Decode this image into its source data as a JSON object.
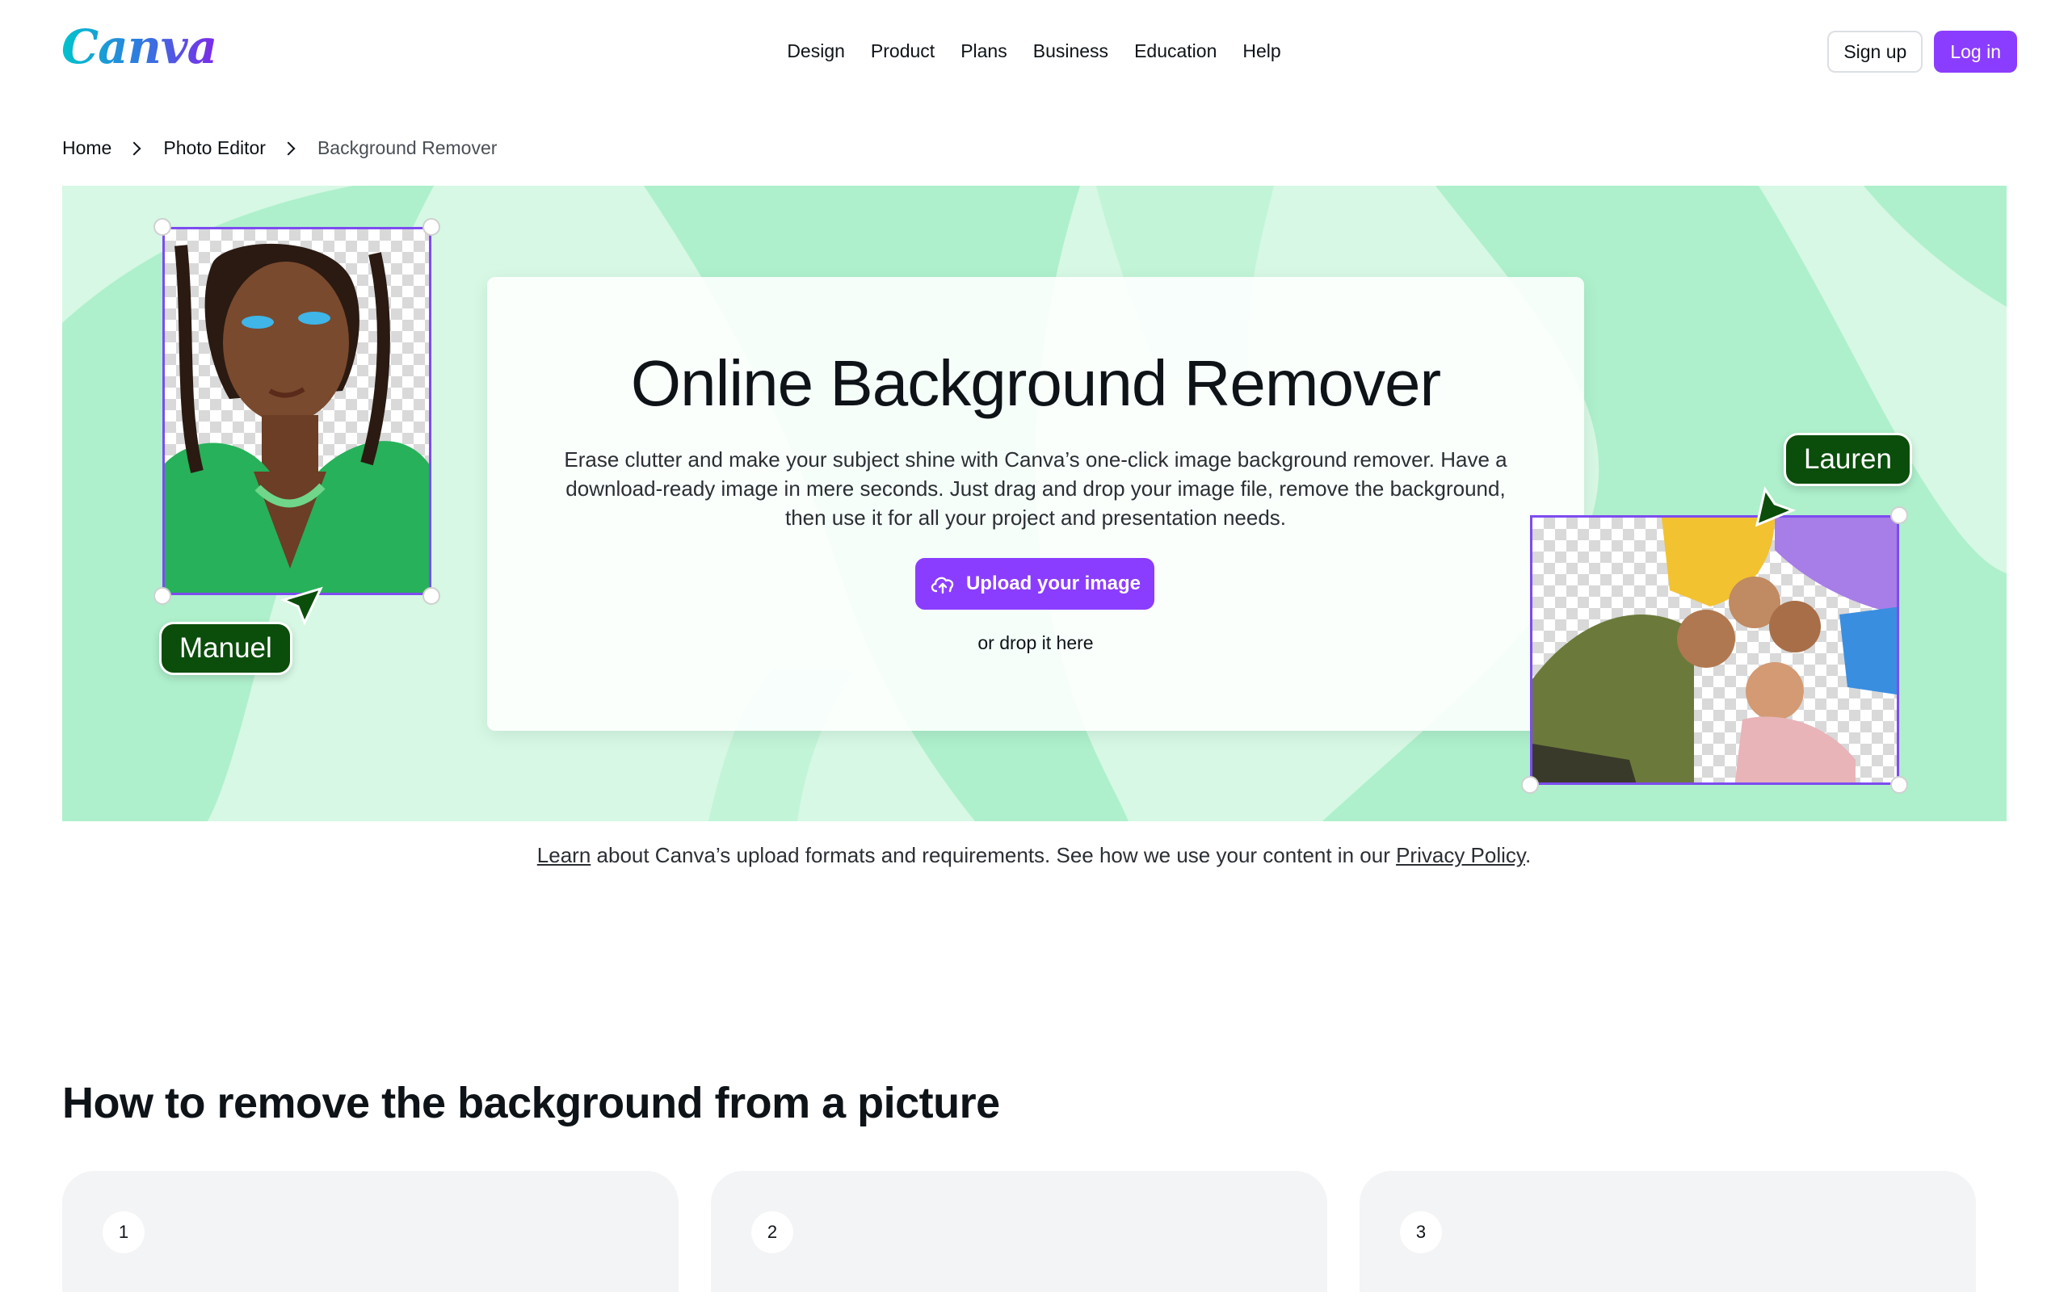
{
  "header": {
    "logo": "Canva",
    "nav": [
      "Design",
      "Product",
      "Plans",
      "Business",
      "Education",
      "Help"
    ],
    "signup_label": "Sign up",
    "login_label": "Log in"
  },
  "breadcrumb": [
    "Home",
    "Photo Editor",
    "Background Remover"
  ],
  "hero": {
    "title": "Online Background Remover",
    "description": "Erase clutter and make your subject shine with Canva’s one-click image background remover. Have a download-ready image in mere seconds. Just drag and drop your image file, remove the background, then use it for all your project and presentation needs.",
    "upload_label": "Upload your image",
    "drop_label": "or drop it here",
    "tag_left": "Manuel",
    "tag_right": "Lauren"
  },
  "note": {
    "learn": "Learn",
    "middle": " about Canva’s upload formats and requirements. See how we use your content in our ",
    "privacy": "Privacy Policy",
    "end": "."
  },
  "howto": {
    "title": "How to remove the background from a picture",
    "steps": [
      "1",
      "2",
      "3"
    ]
  },
  "colors": {
    "accent": "#8b3dff",
    "hero_bg": "#d6f8e4",
    "hero_blob": "#aef0cc",
    "tag_bg": "#0b4d0b"
  },
  "icons": {
    "upload": "cloud-upload-icon",
    "chevron": "chevron-right-icon"
  }
}
